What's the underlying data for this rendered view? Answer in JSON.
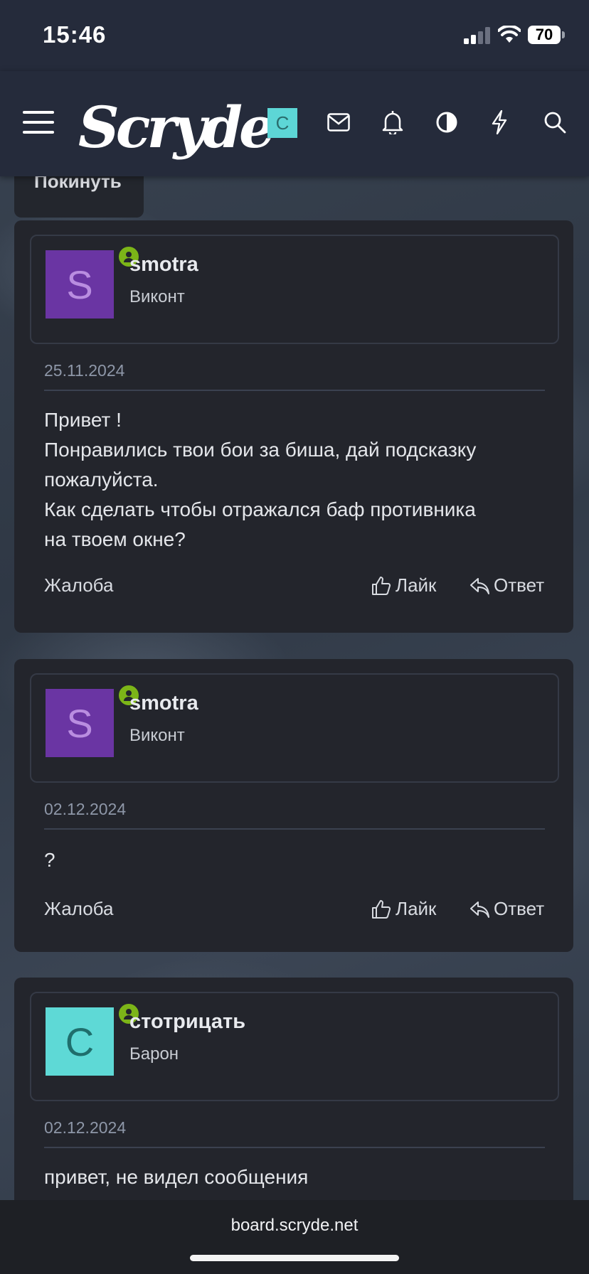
{
  "status": {
    "time": "15:46",
    "battery": "70"
  },
  "header": {
    "logo": "Scryde",
    "user_initial": "C"
  },
  "leave_label": "Покинуть",
  "posts": [
    {
      "username": "smotra",
      "rank": "Виконт",
      "avatar_letter": "S",
      "avatar_bg": "#6a35a3",
      "avatar_fg": "#b98de0",
      "date": "25.11.2024",
      "lines": [
        "Привет !",
        "Понравились твои бои за биша, дай подсказку",
        "пожалуйста.",
        "Как сделать чтобы отражался баф противника",
        "на твоем окне?"
      ],
      "report": "Жалоба",
      "like": "Лайк",
      "reply": "Ответ"
    },
    {
      "username": "smotra",
      "rank": "Виконт",
      "avatar_letter": "S",
      "avatar_bg": "#6a35a3",
      "avatar_fg": "#b98de0",
      "date": "02.12.2024",
      "lines": [
        "?"
      ],
      "report": "Жалоба",
      "like": "Лайк",
      "reply": "Ответ"
    },
    {
      "username": "стотрицать",
      "rank": "Барон",
      "avatar_letter": "С",
      "avatar_bg": "#5ed9d6",
      "avatar_fg": "#1f6e6c",
      "date": "02.12.2024",
      "lines": [
        "привет, не видел сообщения"
      ]
    }
  ],
  "browser": {
    "url": "board.scryde.net"
  },
  "colors": {
    "online": "#7cb518",
    "nav_bg": "#252b3b",
    "card_bg": "#23252c"
  }
}
